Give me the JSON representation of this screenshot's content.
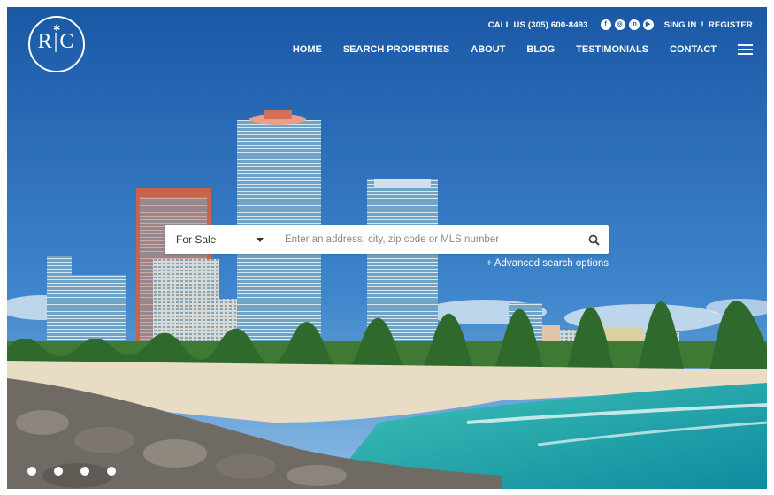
{
  "logo": {
    "text": "R|C",
    "icon": "palm-tree-icon"
  },
  "topbar": {
    "call": "CALL US (305) 600-8493",
    "social": [
      {
        "icon": "facebook-icon",
        "glyph": "f"
      },
      {
        "icon": "instagram-icon",
        "glyph": "◎"
      },
      {
        "icon": "linkedin-icon",
        "glyph": "in"
      },
      {
        "icon": "youtube-icon",
        "glyph": "▶"
      }
    ],
    "signin": "SING IN",
    "separator": "!",
    "register": "REGISTER"
  },
  "nav": {
    "items": [
      "HOME",
      "SEARCH PROPERTIES",
      "ABOUT",
      "BLOG",
      "TESTIMONIALS",
      "CONTACT"
    ],
    "menu_icon": "hamburger-menu-icon"
  },
  "search": {
    "type_value": "For Sale",
    "placeholder": "Enter an address, city, zip code or MLS number",
    "icon": "search-icon"
  },
  "advanced": "+ Advanced search options",
  "carousel": {
    "count": 4
  },
  "colors": {
    "sky": "#1f5fa5",
    "sea": "#2fb8b0",
    "sand": "#e8dcc4",
    "rocks": "#6f6a64"
  }
}
